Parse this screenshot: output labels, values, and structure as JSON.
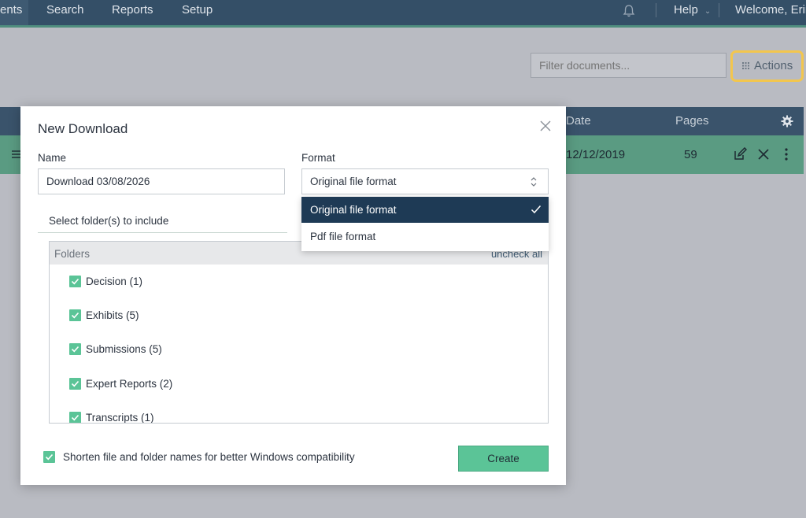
{
  "nav": {
    "items": [
      {
        "label": "ents",
        "left": 0
      },
      {
        "label": "Search"
      },
      {
        "label": "Reports"
      },
      {
        "label": "Setup"
      }
    ],
    "help_label": "Help",
    "welcome_label": "Welcome, Erin"
  },
  "toolbar": {
    "filter_placeholder": "Filter documents...",
    "actions_label": "Actions"
  },
  "table": {
    "columns": [
      "Date",
      "Pages"
    ],
    "row": {
      "date": "12/12/2019",
      "pages": "59"
    }
  },
  "modal": {
    "title": "New Download",
    "name_label": "Name",
    "name_value": "Download 03/08/2026",
    "format_label": "Format",
    "format_value": "Original file format",
    "format_options": [
      {
        "label": "Original file format",
        "selected": true
      },
      {
        "label": "Pdf file format",
        "selected": false
      }
    ],
    "folders_tab_label": "Select folder(s) to include",
    "folders_header": "Folders",
    "uncheck_all_label": "uncheck all",
    "folders": [
      {
        "label": "Decision (1)",
        "checked": true
      },
      {
        "label": "Exhibits (5)",
        "checked": true
      },
      {
        "label": "Submissions (5)",
        "checked": true
      },
      {
        "label": "Expert Reports (2)",
        "checked": true
      },
      {
        "label": "Transcripts (1)",
        "checked": true
      }
    ],
    "shorten_label": "Shorten file and folder names for better Windows compatibility",
    "shorten_checked": true,
    "create_label": "Create"
  },
  "colors": {
    "nav_bg": "#344f67",
    "accent_green": "#5bc497",
    "selected_option_bg": "#1e3a55",
    "actions_highlight": "#f3c64d",
    "overlay": "#b9bbc2"
  },
  "icons": [
    "bell-icon",
    "grid-icon",
    "gear-icon",
    "drag-handle-icon",
    "edit-icon",
    "delete-icon",
    "more-icon",
    "close-icon",
    "select-arrows-icon",
    "checkmark-icon"
  ]
}
